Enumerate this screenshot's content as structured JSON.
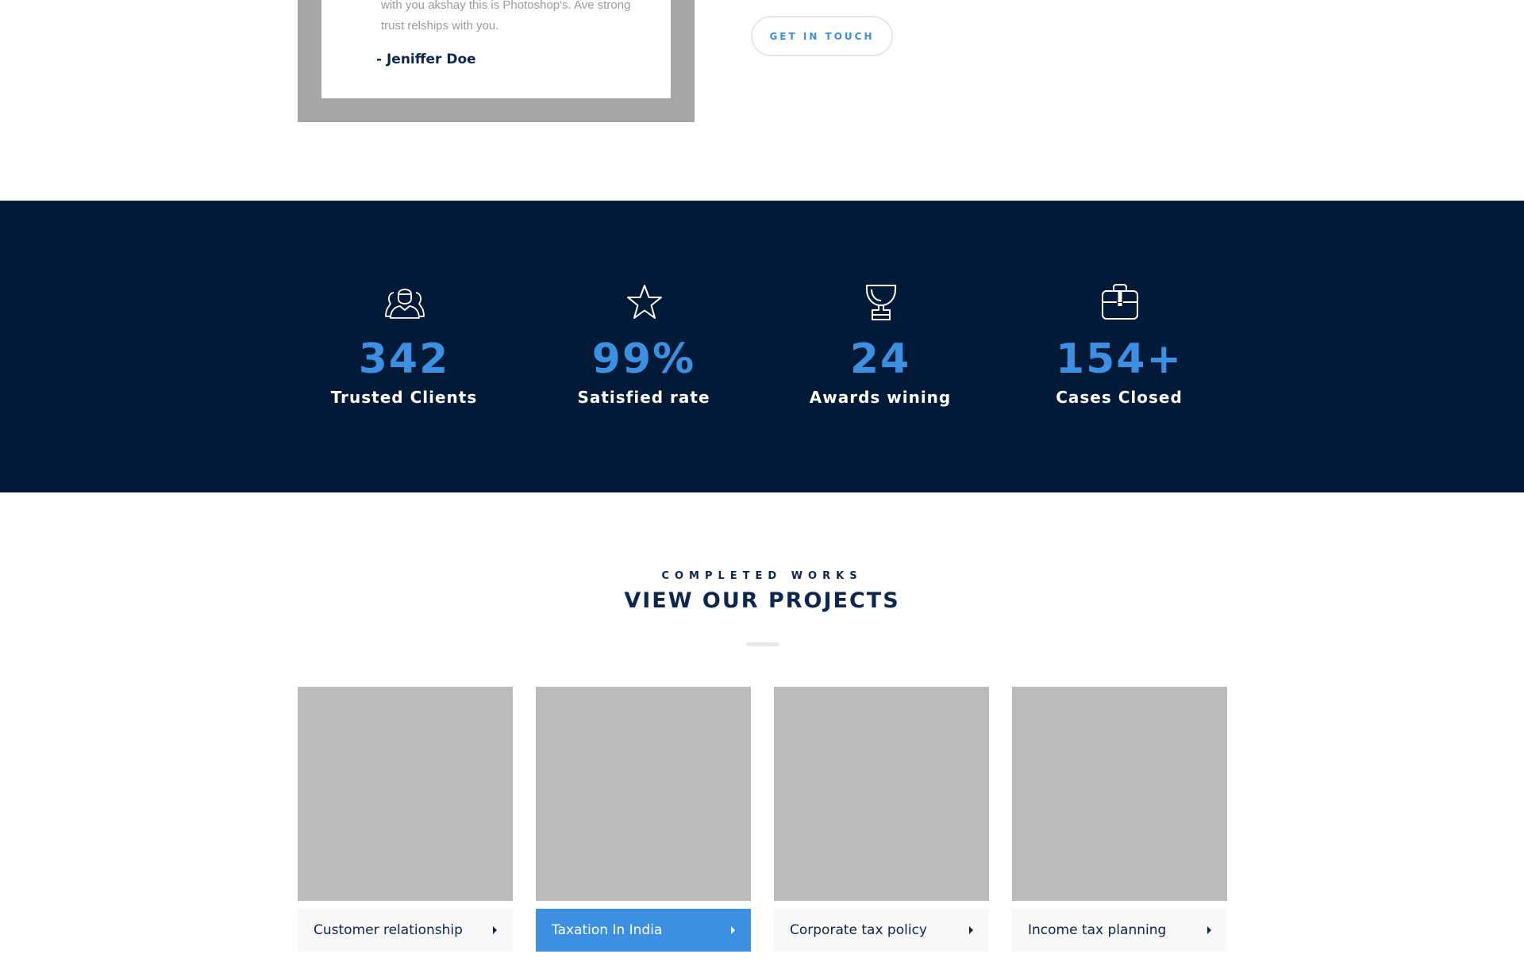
{
  "testimonial": {
    "line1": "with you akshay this is Photoshop's. Ave strong",
    "line2": "trust relships with you.",
    "author": "- Jeniffer Doe"
  },
  "cta": {
    "label": "GET IN TOUCH"
  },
  "stats": [
    {
      "icon": "users-icon",
      "value": "342",
      "label": "Trusted Clients"
    },
    {
      "icon": "star-icon",
      "value": "99%",
      "label": "Satisfied  rate"
    },
    {
      "icon": "trophy-icon",
      "value": "24",
      "label": "Awards wining"
    },
    {
      "icon": "briefcase-icon",
      "value": "154+",
      "label": "Cases Closed"
    }
  ],
  "projects_section": {
    "eyebrow": "COMPLETED WORKS",
    "title": "VIEW OUR PROJECTS",
    "items": [
      {
        "label": "Customer relationship",
        "active": false
      },
      {
        "label": "Taxation In India",
        "active": true
      },
      {
        "label": "Corporate tax policy",
        "active": false
      },
      {
        "label": "Income tax planning",
        "active": false
      }
    ]
  },
  "colors": {
    "navy": "#011a37",
    "accent": "#3d8fe1",
    "heading": "#0d2650",
    "placeholder": "#bbbbbb"
  }
}
